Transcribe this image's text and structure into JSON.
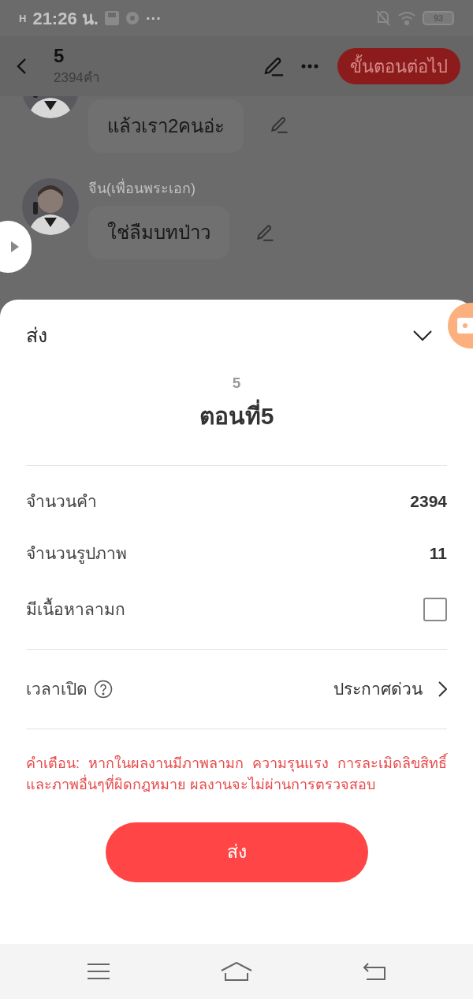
{
  "status_bar": {
    "network": "H",
    "time": "21:26 น.",
    "more": "···",
    "battery": "93"
  },
  "header": {
    "title": "5",
    "subtitle": "2394คำ",
    "next_button": "ขั้นตอนต่อไป"
  },
  "messages": [
    {
      "text": "แล้วเรา2คนอ่ะ"
    },
    {
      "name": "จีน(เพื่อนพระเอก)",
      "text": "ใช่ลืมบทป่าว"
    }
  ],
  "sheet": {
    "title": "ส่ง",
    "episode_number": "5",
    "episode_title": "ตอนที่5",
    "stats": [
      {
        "kind": "value",
        "label": "จำนวนคำ",
        "value": "2394"
      },
      {
        "kind": "value",
        "label": "จำนวนรูปภาพ",
        "value": "11"
      },
      {
        "kind": "checkbox",
        "label": "มีเนื้อหาลามก",
        "checked": false
      }
    ],
    "publish": {
      "label": "เวลาเปิด",
      "value": "ประกาศด่วน"
    },
    "warning": "คำเตือน: หากในผลงานมีภาพลามก ความรุนแรง การละเมิดลิขสิทธิ์และภาพอื่นๆที่ผิดกฎหมาย ผลงานจะไม่ผ่านการตรวจสอบ",
    "submit_button": "ส่ง"
  }
}
